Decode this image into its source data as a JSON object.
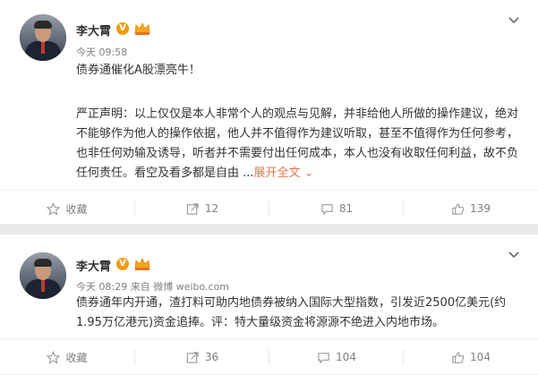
{
  "posts": [
    {
      "author": "李大霄",
      "time": "今天 09:58",
      "source": "",
      "text1": "债券通催化A股漂亮牛！",
      "text2": "严正声明：以上仅仅是本人非常个人的观点与见解，并非给他人所做的操作建议，绝对不能够作为他人的操作依据，他人并不值得作为建议听取，甚至不值得作为任何参考，也非任何劝输及诱导，听者并不需要付出任何成本，本人也没有收取任何利益，故不负任何责任。看空及看多都是自由 ...",
      "expand": "展开全文",
      "favorite": "收藏",
      "reposts": "12",
      "comments": "81",
      "likes": "139"
    },
    {
      "author": "李大霄",
      "time": "今天 08:29",
      "source": "来自 微博 weibo.com",
      "text1": "债券通年内开通，渣打料可助内地债券被纳入国际大型指数，引发近2500亿美元(约1.95万亿港元)资金追捧。评：特大量级资金将源源不绝进入内地市场。",
      "favorite": "收藏",
      "reposts": "36",
      "comments": "104",
      "likes": "104"
    }
  ],
  "colors": {
    "accent": "#eb7350",
    "meta": "#808080",
    "text": "#333333"
  }
}
